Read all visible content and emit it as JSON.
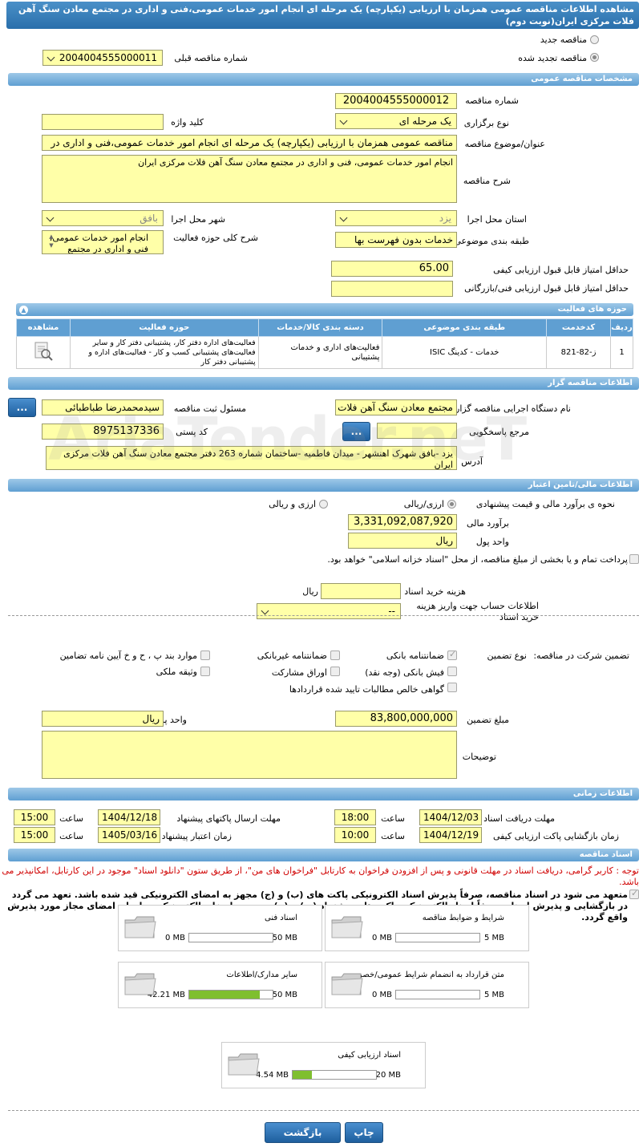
{
  "title": "مشاهده اطلاعات مناقصه عمومی همزمان با ارزیابی (یکپارچه) یک مرحله ای انجام امور خدمات عمومی،فنی و اداری در مجتمع معادن سنگ آهن فلات مرکزی ایران(نوبت دوم)",
  "top": {
    "new_label": "مناقصه جدید",
    "renewed_label": "مناقصه تجدید شده",
    "prev_number_label": "شماره مناقصه قبلی",
    "prev_number": "2004004555000011"
  },
  "sections": {
    "general": "مشخصات مناقصه عمومی",
    "activity": "حوزه های فعالیت",
    "organizer": "اطلاعات مناقصه گزار",
    "finance": "اطلاعات مالی/تامین اعتبار",
    "timing": "اطلاعات زمانی",
    "docs": "اسناد مناقصه"
  },
  "general": {
    "number_label": "شماره مناقصه",
    "number": "2004004555000012",
    "type_label": "نوع برگزاری",
    "type": "یک مرحله ای",
    "keyword_label": "کلید واژه",
    "keyword": "",
    "subject_label": "عنوان/موضوع مناقصه",
    "subject": "مناقصه عمومی همزمان با ارزیابی (یکپارچه) یک مرحله ای انجام امور خدمات عمومی،فنی و اداری در",
    "desc_label": "شرح مناقصه",
    "desc": "انجام امور خدمات عمومی، فنی و اداری در مجتمع معادن سنگ آهن فلات مرکزی ایران",
    "province_label": "استان محل اجرا",
    "province": "یزد",
    "city_label": "شهر محل اجرا",
    "city": "بافق",
    "category_label": "طبقه بندی موضوعی",
    "category": "خدمات بدون فهرست بها",
    "scope_label": "شرح کلی حوزه فعالیت",
    "scope": "انجام امور خدمات عمومی، فنی و اداری در مجتمع",
    "min_quality_label": "حداقل امتیاز قابل قبول ارزیابی کیفی",
    "min_quality": "65.00",
    "min_tech_label": "حداقل امتیاز قابل قبول ارزیابی فنی/بازرگانی",
    "min_tech": ""
  },
  "activity_table": {
    "headers": [
      "ردیف",
      "کدخدمت",
      "طبقه بندی موضوعی",
      "دسته بندی کالا/خدمات",
      "حوزه فعالیت",
      "مشاهده"
    ],
    "rows": [
      {
        "row": "1",
        "code": "ز-82-821",
        "category": "خدمات - کدینگ ISIC",
        "group": "فعالیت‌های اداری و خدمات پشتیبانی",
        "field": "فعالیت‌های اداره دفتر کار، پشتیبانی دفتر کار و سایر فعالیت‌های پشتیبانی کسب و کار - فعالیت‌های اداره و پشتیبانی دفتر کار"
      }
    ]
  },
  "organizer": {
    "org_label": "نام دستگاه اجرایی مناقصه گزار",
    "org": "مجتمع معادن سنگ آهن فلات مرکزی ایران",
    "reg_label": "مسئول ثبت مناقصه",
    "reg": "سیدمحمدرضا طباطبائی",
    "ref_label": "مرجع پاسخگویی",
    "ref": "",
    "postal_label": "کد پستی",
    "postal": "8975137336",
    "address_label": "آدرس",
    "address": "یزد -بافق شهرک اهنشهر - میدان فاطمیه -ساختمان شماره 263 دفتر مجتمع معادن سنگ آهن فلات مرکزی ایران",
    "btn": "..."
  },
  "finance": {
    "estimate_mode_label": "نحوه ی برآورد مالی و قیمت پیشنهادی",
    "opt_rial": "ارزی/ریالی",
    "opt_both": "ارزی و ریالی",
    "estimate_label": "برآورد مالی",
    "estimate": "3,331,092,087,920",
    "currency_label": "واحد پول",
    "currency": "ریال",
    "treasury_note": "پرداخت تمام و یا بخشی از مبلغ مناقصه، از محل \"اسناد خزانه اسلامی\" خواهد بود.",
    "doc_cost_label": "هزینه خرید اسناد",
    "doc_cost_currency": "ریال",
    "account_label": "اطلاعات حساب جهت واریز هزینه خرید اسناد",
    "account_value": "--"
  },
  "guarantee": {
    "participate_label": "تضمین شرکت در مناقصه:",
    "type_label": "نوع تضمین",
    "opts": {
      "bank": "ضمانتنامه بانکی",
      "nonbank": "ضمانتنامه غیربانکی",
      "clauses": "موارد بند پ ، ح و خ آیین نامه تضامین",
      "cash": "فیش بانکی (وجه نقد)",
      "bonds": "اوراق مشارکت",
      "property": "وثیقه ملکی",
      "claims": "گواهی خالص مطالبات تایید شده قراردادها"
    },
    "amount_label": "مبلغ تضمین",
    "amount": "83,800,000,000",
    "currency_label": "واحد پول",
    "currency": "ریال",
    "notes_label": "توضیحات"
  },
  "timing": {
    "doc_deadline_label": "مهلت دریافت اسناد",
    "doc_deadline": "1404/12/03",
    "doc_time": "18:00",
    "send_deadline_label": "مهلت ارسال پاکتهای پیشنهاد",
    "send_deadline": "1404/12/18",
    "send_time": "15:00",
    "open_label": "زمان بازگشایی پاکت ارزیابی کیفی",
    "open_date": "1404/12/19",
    "open_time": "10:00",
    "valid_label": "زمان اعتبار پیشنهاد",
    "valid_date": "1405/03/16",
    "valid_time": "15:00",
    "time_label": "ساعت"
  },
  "docs": {
    "notice": "توجه : کاربر گرامی، دریافت اسناد در مهلت قانونی و پس از افزودن فراخوان به کارتابل \"فراخوان های من\"، از طریق ستون \"دانلود اسناد\" موجود در این کارتابل، امکانپذیر می باشد.",
    "pledge": "متعهد می شود در اسناد مناقصه، صرفاً پذیرش اسناد الکترونیکی پاکت های (ب) و (ج) مجهز به امضای الکترونیکی قید شده باشد. تعهد می گردد در بازگشایی و پذیرش اسناد، صرفاً اسناد الکترونیکی پاکت های پیشنهاد (ب) و (ج) مجهز به امضای الکترونیکی صاحبان امضای مجاز مورد پذیرش واقع گردد.",
    "files": [
      {
        "title": "شرایط و ضوابط مناقصه",
        "max": "5 MB",
        "cur": "0 MB",
        "fill": 0
      },
      {
        "title": "اسناد فنی",
        "max": "50 MB",
        "cur": "0 MB",
        "fill": 0
      },
      {
        "title": "متن قرارداد به انضمام شرایط عمومی/خصوصی",
        "max": "5 MB",
        "cur": "0 MB",
        "fill": 0
      },
      {
        "title": "سایر مدارک/اطلاعات",
        "max": "50 MB",
        "cur": "42.21 MB",
        "fill": 0.844
      },
      {
        "title": "اسناد ارزیابی کیفی",
        "max": "20 MB",
        "cur": "4.54 MB",
        "fill": 0.227
      }
    ]
  },
  "actions": {
    "print": "چاپ",
    "back": "بازگشت"
  },
  "watermark": "AriaTender.neT"
}
